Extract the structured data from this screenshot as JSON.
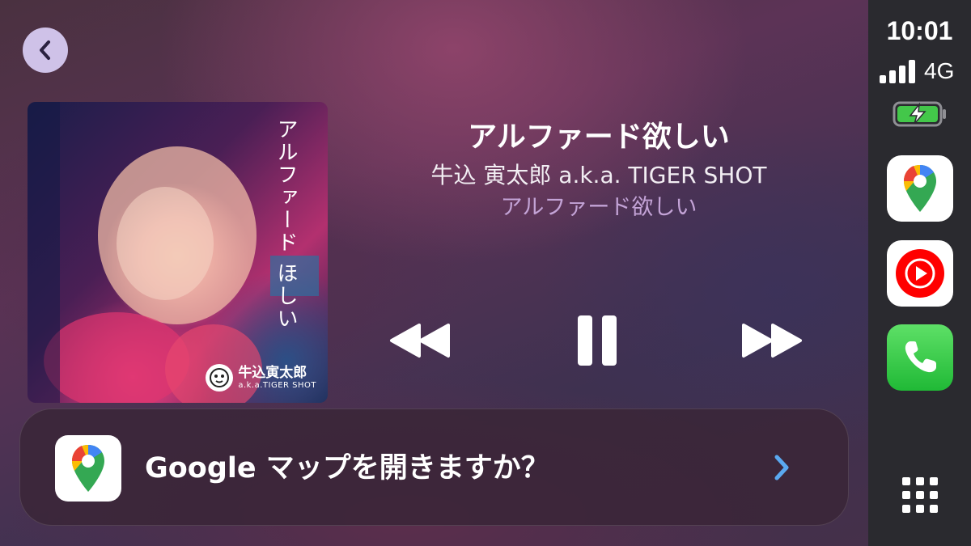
{
  "status": {
    "time": "10:01",
    "network": "4G",
    "battery_color": "#43c74a"
  },
  "now_playing": {
    "title": "アルファード欲しい",
    "artist": "牛込 寅太郎 a.k.a. TIGER SHOT",
    "album": "アルファード欲しい",
    "album_art": {
      "vertical_text": "アルファード ほしい",
      "artist_jp": "牛込寅太郎",
      "artist_en": "a.k.a.TIGER SHOT"
    },
    "state": "playing"
  },
  "controls": {
    "rewind_icon": "rewind-icon",
    "pause_icon": "pause-icon",
    "forward_icon": "fast-forward-icon"
  },
  "banner": {
    "text": "Google マップを開きますか？",
    "icon": "google-maps-icon",
    "chevron_color": "#5aa9f0"
  },
  "dock": {
    "apps": [
      "Google Maps",
      "YouTube Music",
      "Phone"
    ],
    "grid_icon": "app-grid-icon"
  },
  "colors": {
    "album_subtitle": "#c3a3d6",
    "sidebar_bg": "#2a2a2f",
    "back_button_bg": "#cfc2e8"
  }
}
